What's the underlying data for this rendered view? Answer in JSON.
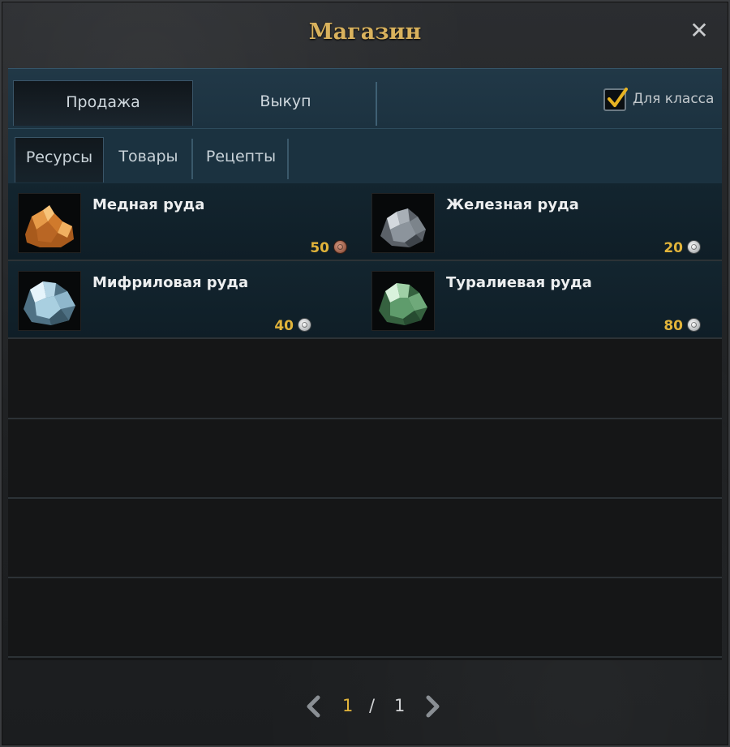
{
  "window": {
    "title": "Магазин",
    "close_icon": "close-icon"
  },
  "main_tabs": [
    {
      "label": "Продажа",
      "active": true
    },
    {
      "label": "Выкуп",
      "active": false
    }
  ],
  "class_filter": {
    "label": "Для класса",
    "checked": true
  },
  "sub_tabs": [
    {
      "label": "Ресурсы",
      "active": true
    },
    {
      "label": "Товары",
      "active": false
    },
    {
      "label": "Рецепты",
      "active": false
    }
  ],
  "items": [
    {
      "name": "Медная руда",
      "price": "50",
      "currency": "copper",
      "icon": "copper-ore-icon",
      "color": "#c6772d"
    },
    {
      "name": "Железная руда",
      "price": "20",
      "currency": "silver",
      "icon": "iron-ore-icon",
      "color": "#8c949c"
    },
    {
      "name": "Мифриловая руда",
      "price": "40",
      "currency": "silver",
      "icon": "mithril-ore-icon",
      "color": "#8fb7cc"
    },
    {
      "name": "Туралиевая руда",
      "price": "80",
      "currency": "silver",
      "icon": "turalium-ore-icon",
      "color": "#5f9c6c"
    }
  ],
  "pager": {
    "current": "1",
    "separator": "/",
    "total": "1"
  },
  "colors": {
    "accent_gold": "#d9b25d",
    "price_gold": "#e2b43a",
    "tab_blue": "#1c3240"
  }
}
